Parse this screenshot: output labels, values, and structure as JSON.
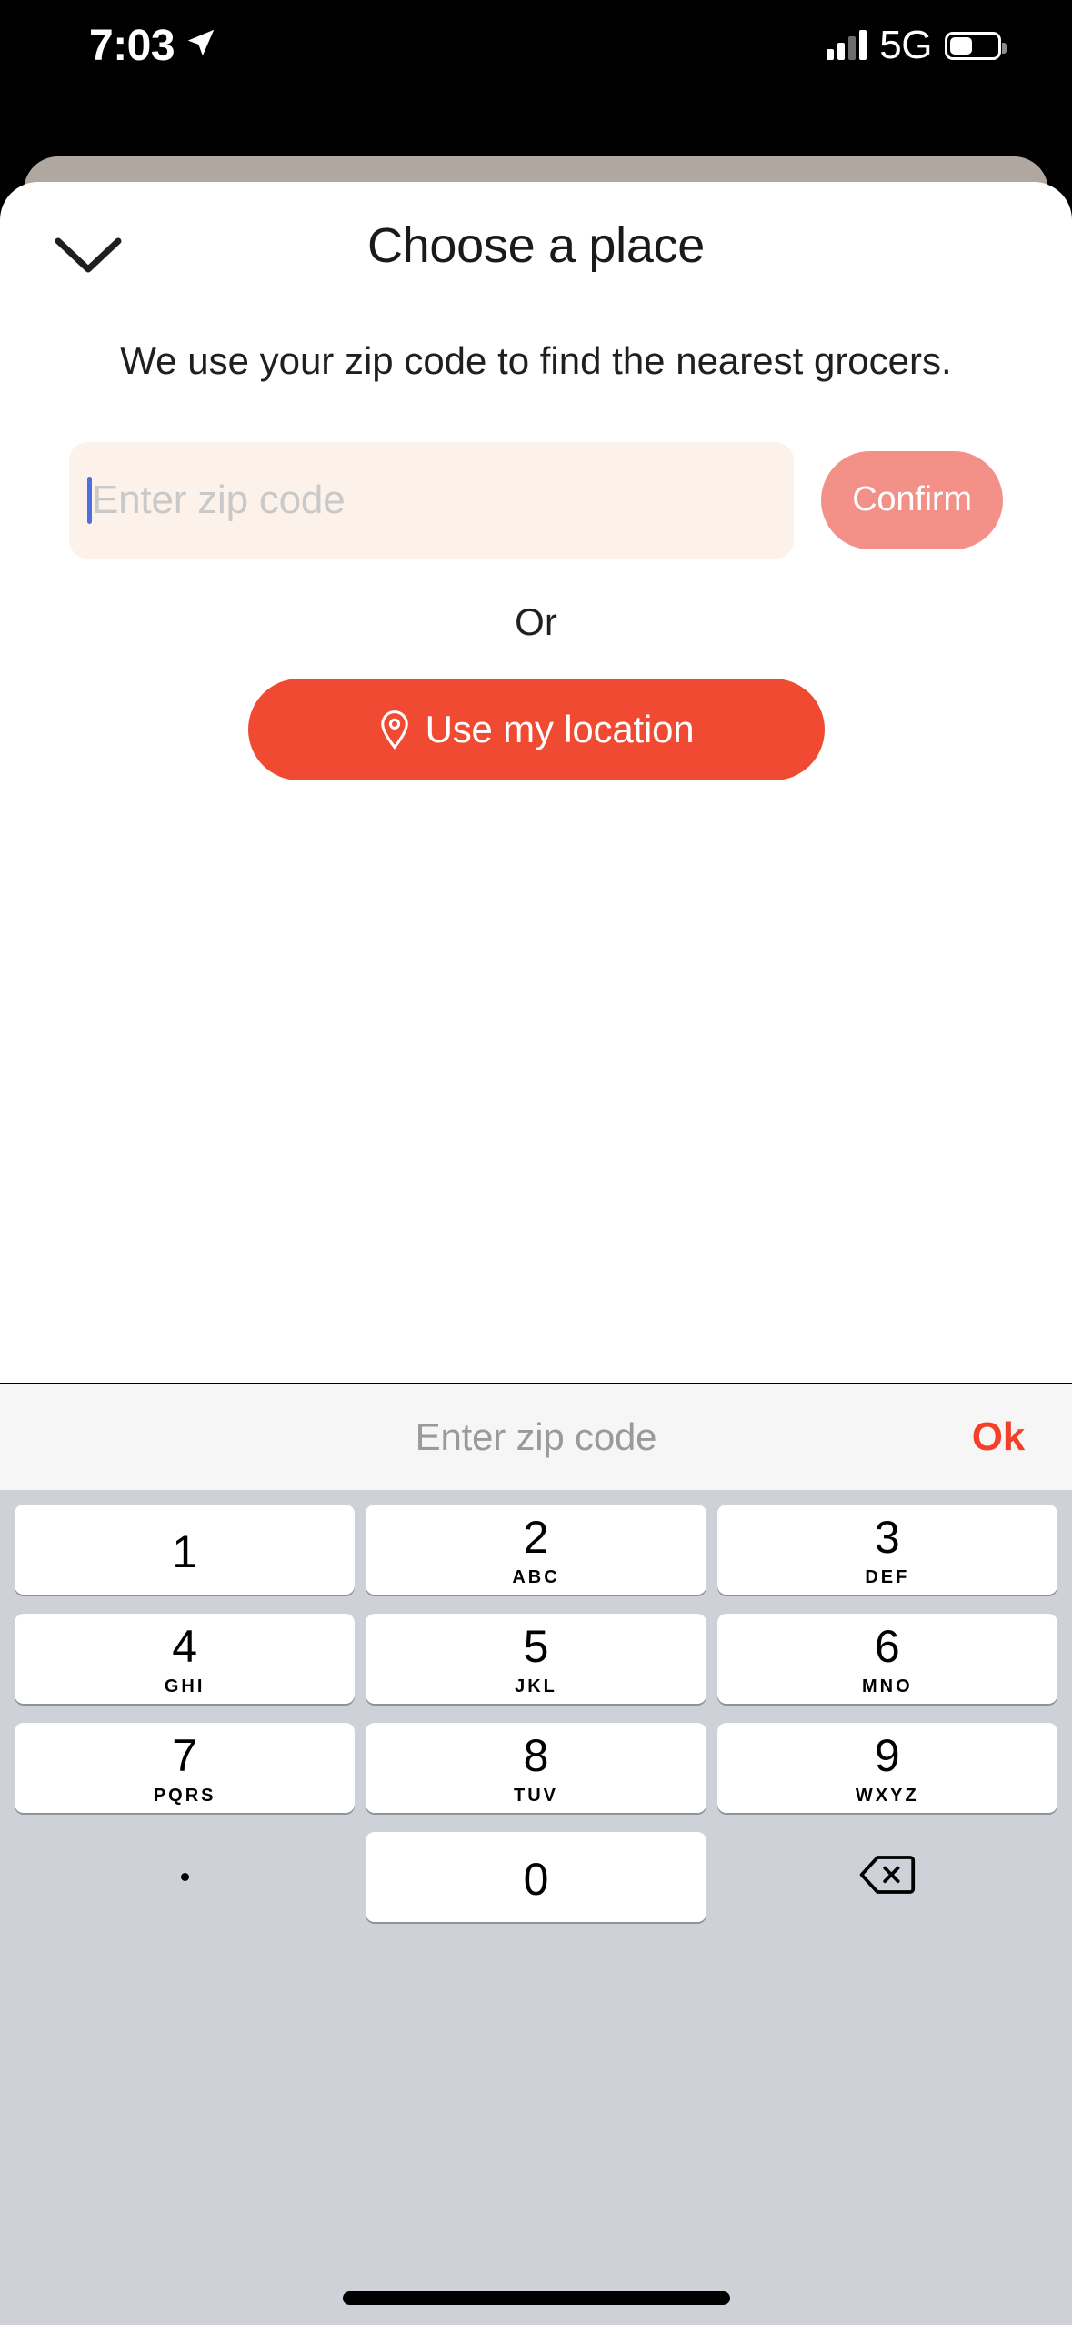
{
  "status_bar": {
    "time": "7:03",
    "location_arrow_icon": "location-arrow-icon",
    "signal_icon": "cellular-signal-icon",
    "network": "5G",
    "battery_icon": "battery-icon"
  },
  "sheet": {
    "dismiss_icon": "chevron-down-icon",
    "title": "Choose a place",
    "subtitle": "We use your zip code to find the nearest grocers.",
    "zip_input": {
      "value": "",
      "placeholder": "Enter zip code"
    },
    "confirm_label": "Confirm",
    "or_label": "Or",
    "location_button": {
      "label": "Use my location",
      "icon": "map-pin-icon"
    }
  },
  "keyboard": {
    "toolbar": {
      "hint": "Enter zip code",
      "done_label": "Ok"
    },
    "rows": [
      [
        {
          "digit": "1",
          "letters": ""
        },
        {
          "digit": "2",
          "letters": "ABC"
        },
        {
          "digit": "3",
          "letters": "DEF"
        }
      ],
      [
        {
          "digit": "4",
          "letters": "GHI"
        },
        {
          "digit": "5",
          "letters": "JKL"
        },
        {
          "digit": "6",
          "letters": "MNO"
        }
      ],
      [
        {
          "digit": "7",
          "letters": "PQRS"
        },
        {
          "digit": "8",
          "letters": "TUV"
        },
        {
          "digit": "9",
          "letters": "WXYZ"
        }
      ]
    ],
    "last_row": {
      "period": ".",
      "zero": "0",
      "backspace_icon": "backspace-delete-icon"
    }
  },
  "colors": {
    "accent": "#f04a32",
    "confirm_disabled": "#f39189",
    "input_bg": "#fdf2e9",
    "sheet_behind": "#b0a8a0",
    "keyboard_bg": "#ced1d8",
    "ok_red": "#f4402a",
    "caret_blue": "#4b6fdc"
  }
}
